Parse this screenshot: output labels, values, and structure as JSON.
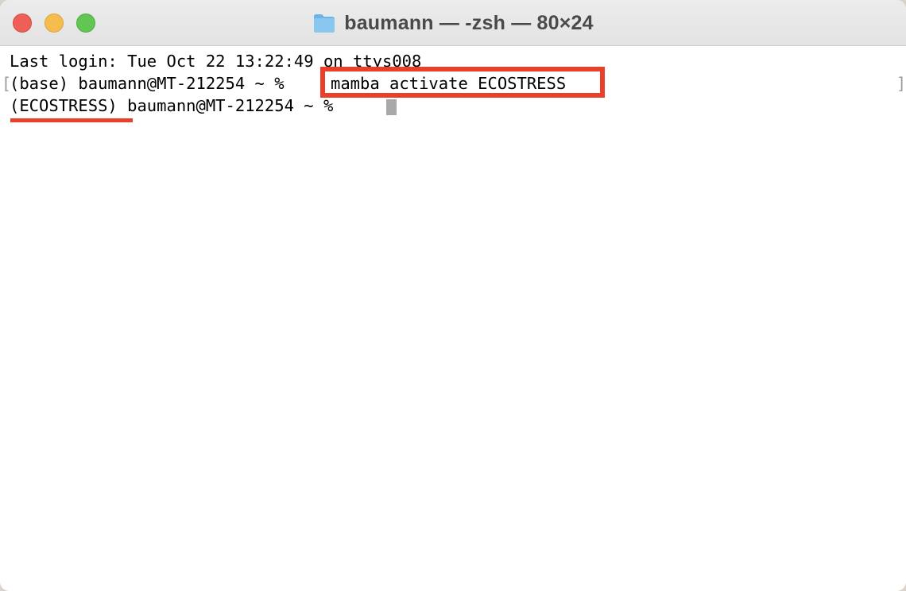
{
  "window": {
    "title": "baumann — -zsh — 80×24"
  },
  "traffic_lights": {
    "close": "close",
    "minimize": "minimize",
    "zoom": "zoom"
  },
  "terminal": {
    "lines": [
      "Last login: Tue Oct 22 13:22:49 on ttys008",
      "(base) baumann@MT-212254 ~ % ",
      "(ECOSTRESS) baumann@MT-212254 ~ % "
    ],
    "command": "mamba activate ECOSTRESS",
    "bracket_left": "[",
    "bracket_right": "]"
  },
  "colors": {
    "highlight": "#e8402a",
    "cursor": "#a9a9a9"
  },
  "icons": {
    "title_icon": "folder-icon"
  }
}
